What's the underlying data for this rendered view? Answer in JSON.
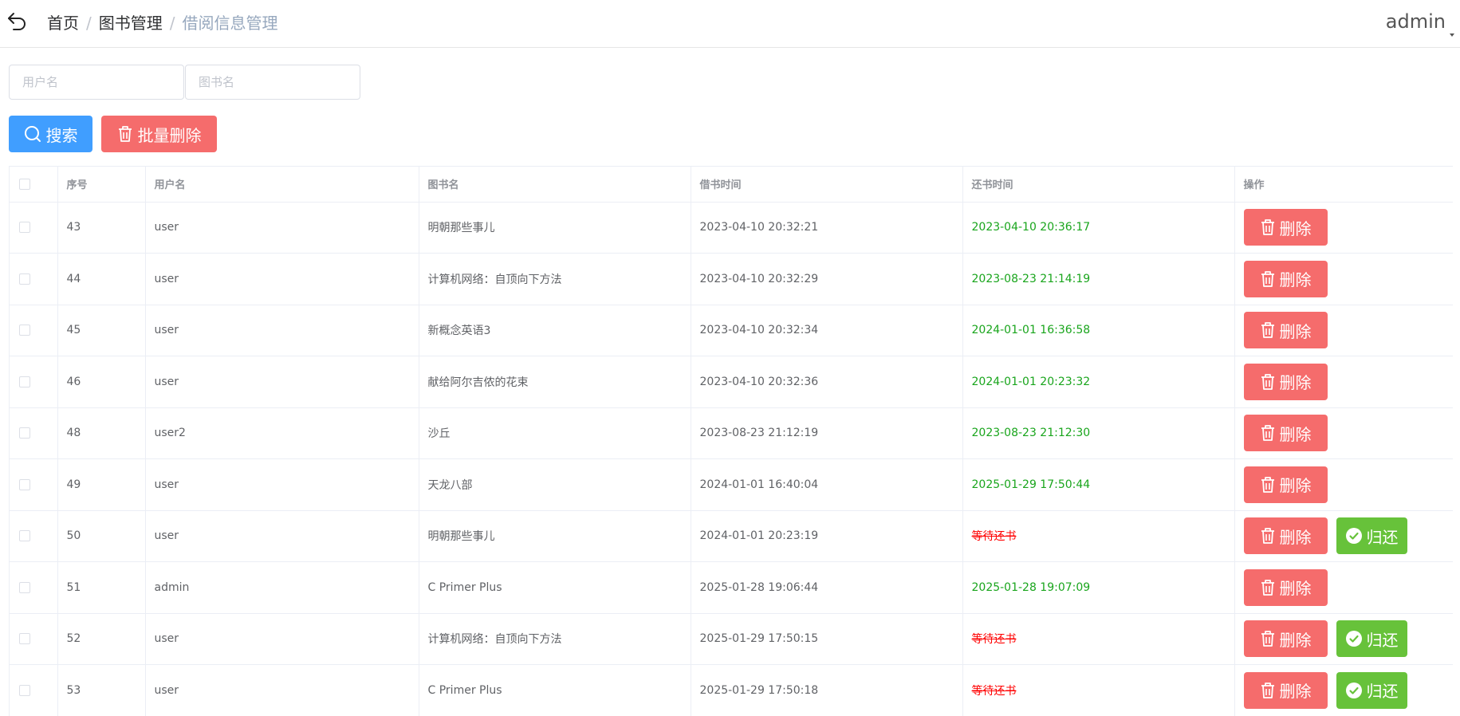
{
  "header": {
    "breadcrumb": [
      "首页",
      "图书管理",
      "借阅信息管理"
    ],
    "breadcrumb_sep": "/",
    "user": "admin"
  },
  "search": {
    "username_placeholder": "用户名",
    "bookname_placeholder": "图书名",
    "search_label": "搜索",
    "batch_delete_label": "批量删除"
  },
  "table": {
    "columns": [
      "序号",
      "用户名",
      "图书名",
      "借书时间",
      "还书时间",
      "操作"
    ],
    "delete_label": "删除",
    "return_label": "归还",
    "rows": [
      {
        "id": "43",
        "user": "user",
        "book": "明朝那些事儿",
        "borrow": "2023-04-10 20:32:21",
        "ret": "2023-04-10 20:36:17",
        "returned": true
      },
      {
        "id": "44",
        "user": "user",
        "book": "计算机网络：自顶向下方法",
        "borrow": "2023-04-10 20:32:29",
        "ret": "2023-08-23 21:14:19",
        "returned": true
      },
      {
        "id": "45",
        "user": "user",
        "book": "新概念英语3",
        "borrow": "2023-04-10 20:32:34",
        "ret": "2024-01-01 16:36:58",
        "returned": true
      },
      {
        "id": "46",
        "user": "user",
        "book": "献给阿尔吉侬的花束",
        "borrow": "2023-04-10 20:32:36",
        "ret": "2024-01-01 20:23:32",
        "returned": true
      },
      {
        "id": "48",
        "user": "user2",
        "book": "沙丘",
        "borrow": "2023-08-23 21:12:19",
        "ret": "2023-08-23 21:12:30",
        "returned": true
      },
      {
        "id": "49",
        "user": "user",
        "book": "天龙八部",
        "borrow": "2024-01-01 16:40:04",
        "ret": "2025-01-29 17:50:44",
        "returned": true
      },
      {
        "id": "50",
        "user": "user",
        "book": "明朝那些事儿",
        "borrow": "2024-01-01 20:23:19",
        "ret": "等待还书",
        "returned": false
      },
      {
        "id": "51",
        "user": "admin",
        "book": "C Primer Plus",
        "borrow": "2025-01-28 19:06:44",
        "ret": "2025-01-28 19:07:09",
        "returned": true
      },
      {
        "id": "52",
        "user": "user",
        "book": "计算机网络：自顶向下方法",
        "borrow": "2025-01-29 17:50:15",
        "ret": "等待还书",
        "returned": false
      },
      {
        "id": "53",
        "user": "user",
        "book": "C Primer Plus",
        "borrow": "2025-01-29 17:50:18",
        "ret": "等待还书",
        "returned": false
      }
    ]
  },
  "colors": {
    "primary": "#409eff",
    "danger": "#f56c6c",
    "success": "#67c23a",
    "returned_text": "#19a51c",
    "pending_text": "#ff0000"
  },
  "icons": {
    "back": "back-arrow-icon",
    "search": "search-icon",
    "trash": "trash-icon",
    "check": "check-circle-icon"
  }
}
